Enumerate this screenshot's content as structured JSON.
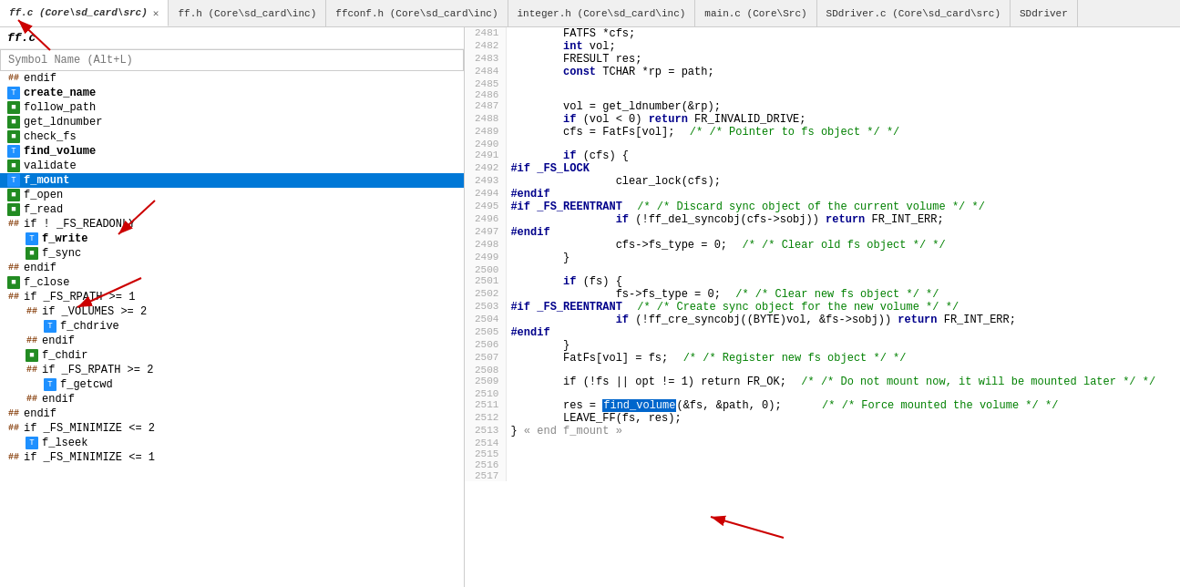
{
  "tabs": [
    {
      "id": "ff-c",
      "label": "ff.c (Core\\sd_card\\src)",
      "active": true,
      "closeable": true
    },
    {
      "id": "ff-h",
      "label": "ff.h (Core\\sd_card\\inc)",
      "active": false,
      "closeable": false
    },
    {
      "id": "ffconf-h",
      "label": "ffconf.h (Core\\sd_card\\inc)",
      "active": false,
      "closeable": false
    },
    {
      "id": "integer-h",
      "label": "integer.h (Core\\sd_card\\inc)",
      "active": false,
      "closeable": false
    },
    {
      "id": "main-c",
      "label": "main.c (Core\\Src)",
      "active": false,
      "closeable": false
    },
    {
      "id": "sddriver-c",
      "label": "SDdriver.c (Core\\sd_card\\src)",
      "active": false,
      "closeable": false
    },
    {
      "id": "sddriver2",
      "label": "SDdriver",
      "active": false,
      "closeable": false
    }
  ],
  "file_title": "ff.c",
  "search_placeholder": "Symbol Name (Alt+L)",
  "symbols": [
    {
      "indent": 0,
      "icon": "hash",
      "label": "endif",
      "selected": false
    },
    {
      "indent": 0,
      "icon": "blue",
      "label": "create_name",
      "selected": false,
      "bold": true
    },
    {
      "indent": 0,
      "icon": "green",
      "label": "follow_path",
      "selected": false
    },
    {
      "indent": 0,
      "icon": "green",
      "label": "get_ldnumber",
      "selected": false
    },
    {
      "indent": 0,
      "icon": "green",
      "label": "check_fs",
      "selected": false
    },
    {
      "indent": 0,
      "icon": "blue",
      "label": "find_volume",
      "selected": false,
      "bold": true
    },
    {
      "indent": 0,
      "icon": "green",
      "label": "validate",
      "selected": false
    },
    {
      "indent": 0,
      "icon": "blue",
      "label": "f_mount",
      "selected": true,
      "bold": true
    },
    {
      "indent": 0,
      "icon": "green",
      "label": "f_open",
      "selected": false
    },
    {
      "indent": 0,
      "icon": "green",
      "label": "f_read",
      "selected": false
    },
    {
      "indent": 0,
      "icon": "hash",
      "label": "if ! _FS_READONLY",
      "selected": false
    },
    {
      "indent": 1,
      "icon": "blue",
      "label": "f_write",
      "selected": false,
      "bold": true
    },
    {
      "indent": 1,
      "icon": "green",
      "label": "f_sync",
      "selected": false
    },
    {
      "indent": 0,
      "icon": "hash",
      "label": "endif",
      "selected": false
    },
    {
      "indent": 0,
      "icon": "green",
      "label": "f_close",
      "selected": false
    },
    {
      "indent": 0,
      "icon": "hash",
      "label": "if _FS_RPATH >= 1",
      "selected": false
    },
    {
      "indent": 1,
      "icon": "hash",
      "label": "if _VOLUMES >= 2",
      "selected": false
    },
    {
      "indent": 2,
      "icon": "blue",
      "label": "f_chdrive",
      "selected": false
    },
    {
      "indent": 1,
      "icon": "hash",
      "label": "endif",
      "selected": false
    },
    {
      "indent": 1,
      "icon": "green",
      "label": "f_chdir",
      "selected": false
    },
    {
      "indent": 1,
      "icon": "hash",
      "label": "if _FS_RPATH >= 2",
      "selected": false
    },
    {
      "indent": 2,
      "icon": "blue",
      "label": "f_getcwd",
      "selected": false
    },
    {
      "indent": 1,
      "icon": "hash",
      "label": "endif",
      "selected": false
    },
    {
      "indent": 0,
      "icon": "hash",
      "label": "endif",
      "selected": false
    },
    {
      "indent": 0,
      "icon": "hash",
      "label": "if _FS_MINIMIZE <= 2",
      "selected": false
    },
    {
      "indent": 1,
      "icon": "blue",
      "label": "f_lseek",
      "selected": false
    },
    {
      "indent": 0,
      "icon": "hash",
      "label": "if _FS_MINIMIZE <= 1",
      "selected": false
    }
  ],
  "code_lines": [
    {
      "num": 2481,
      "tokens": [
        {
          "t": "        FATFS *cfs;",
          "c": ""
        }
      ]
    },
    {
      "num": 2482,
      "tokens": [
        {
          "t": "        int vol;",
          "c": ""
        }
      ]
    },
    {
      "num": 2483,
      "tokens": [
        {
          "t": "        FRESULT res;",
          "c": ""
        }
      ]
    },
    {
      "num": 2484,
      "tokens": [
        {
          "t": "        const TCHAR *rp = path;",
          "c": ""
        }
      ]
    },
    {
      "num": 2485,
      "tokens": [
        {
          "t": "",
          "c": ""
        }
      ]
    },
    {
      "num": 2486,
      "tokens": [
        {
          "t": "",
          "c": ""
        }
      ]
    },
    {
      "num": 2487,
      "tokens": [
        {
          "t": "        vol = get_ldnumber(&rp);",
          "c": ""
        }
      ]
    },
    {
      "num": 2488,
      "tokens": [
        {
          "t": "        if (vol < 0) return FR_INVALID_DRIVE;",
          "c": ""
        }
      ]
    },
    {
      "num": 2489,
      "tokens": [
        {
          "t": "        cfs = FatFs[vol];",
          "c": "cm",
          "extra": "                              /* Pointer to fs object */"
        }
      ]
    },
    {
      "num": 2490,
      "tokens": [
        {
          "t": "",
          "c": ""
        }
      ]
    },
    {
      "num": 2491,
      "tokens": [
        {
          "t": "        if (cfs) {",
          "c": ""
        }
      ]
    },
    {
      "num": 2492,
      "tokens": [
        {
          "t": "#if _FS_LOCK",
          "c": "preproc"
        }
      ]
    },
    {
      "num": 2493,
      "tokens": [
        {
          "t": "                clear_lock(cfs);",
          "c": ""
        }
      ]
    },
    {
      "num": 2494,
      "tokens": [
        {
          "t": "#endif",
          "c": "preproc"
        }
      ]
    },
    {
      "num": 2495,
      "tokens": [
        {
          "t": "#if _FS_REENTRANT",
          "c": "preproc",
          "extra": "                              /* Discard sync object of the current volume */"
        }
      ]
    },
    {
      "num": 2496,
      "tokens": [
        {
          "t": "                if (!ff_del_syncobj(cfs->sobj)) return FR_INT_ERR;",
          "c": ""
        }
      ]
    },
    {
      "num": 2497,
      "tokens": [
        {
          "t": "#endif",
          "c": "preproc"
        }
      ]
    },
    {
      "num": 2498,
      "tokens": [
        {
          "t": "                cfs->fs_type = 0;",
          "c": "cm",
          "extra": "                      /* Clear old fs object */"
        }
      ]
    },
    {
      "num": 2499,
      "tokens": [
        {
          "t": "        }",
          "c": ""
        }
      ]
    },
    {
      "num": 2500,
      "tokens": [
        {
          "t": "",
          "c": ""
        }
      ]
    },
    {
      "num": 2501,
      "tokens": [
        {
          "t": "        if (fs) {",
          "c": ""
        }
      ]
    },
    {
      "num": 2502,
      "tokens": [
        {
          "t": "                fs->fs_type = 0;",
          "c": "cm",
          "extra": "                        /* Clear new fs object */"
        }
      ]
    },
    {
      "num": 2503,
      "tokens": [
        {
          "t": "#if _FS_REENTRANT",
          "c": "preproc",
          "extra": "                              /* Create sync object for the new volume */"
        }
      ]
    },
    {
      "num": 2504,
      "tokens": [
        {
          "t": "                if (!ff_cre_syncobj((BYTE)vol, &fs->sobj)) return FR_INT_ERR;",
          "c": ""
        }
      ]
    },
    {
      "num": 2505,
      "tokens": [
        {
          "t": "#endif",
          "c": "preproc"
        }
      ]
    },
    {
      "num": 2506,
      "tokens": [
        {
          "t": "        }",
          "c": ""
        }
      ]
    },
    {
      "num": 2507,
      "tokens": [
        {
          "t": "        FatFs[vol] = fs;",
          "c": "cm",
          "extra": "                              /* Register new fs object */"
        }
      ]
    },
    {
      "num": 2508,
      "tokens": [
        {
          "t": "",
          "c": ""
        }
      ]
    },
    {
      "num": 2509,
      "tokens": [
        {
          "t": "        if (!fs || opt != 1) return FR_OK;",
          "c": "cm",
          "extra": "  /* Do not mount now, it will be mounted later */"
        }
      ]
    },
    {
      "num": 2510,
      "tokens": [
        {
          "t": "",
          "c": ""
        }
      ]
    },
    {
      "num": 2511,
      "tokens": [
        {
          "t": "        res = ",
          "c": "",
          "hl": "find_volume",
          "after": "(&fs, &path, 0);",
          "hlcm": "/* Force mounted the volume */"
        }
      ]
    },
    {
      "num": 2512,
      "tokens": [
        {
          "t": "        LEAVE_FF(fs, res);",
          "c": ""
        }
      ]
    },
    {
      "num": 2513,
      "tokens": [
        {
          "t": "} « end f_mount »",
          "c": "cm2"
        }
      ]
    },
    {
      "num": 2514,
      "tokens": [
        {
          "t": "",
          "c": ""
        }
      ]
    },
    {
      "num": 2515,
      "tokens": [
        {
          "t": "",
          "c": ""
        }
      ]
    },
    {
      "num": 2516,
      "tokens": [
        {
          "t": "",
          "c": ""
        }
      ]
    },
    {
      "num": 2517,
      "tokens": [
        {
          "t": "",
          "c": ""
        }
      ]
    }
  ]
}
